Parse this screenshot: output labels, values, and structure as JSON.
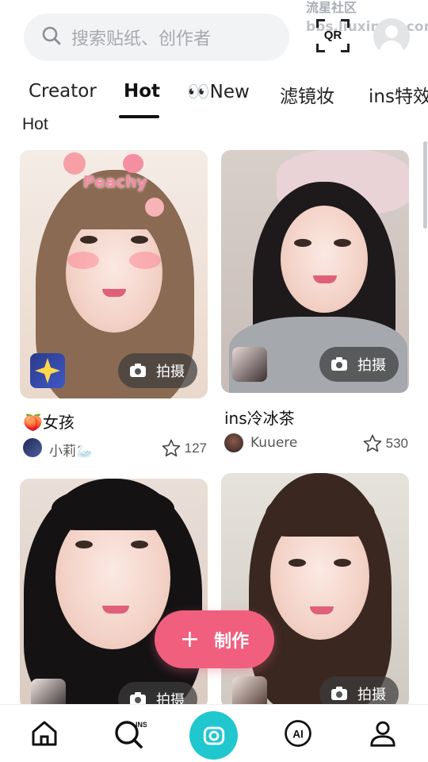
{
  "watermark": {
    "line1": "流星社区",
    "line2": "bbs.liuxingw.com"
  },
  "search": {
    "placeholder": "搜索贴纸、创作者"
  },
  "header": {
    "qr_label": "QR"
  },
  "tabs": [
    {
      "label": "Creator",
      "active": false
    },
    {
      "label": "Hot",
      "active": true
    },
    {
      "label": "👀New",
      "active": false
    },
    {
      "label": "滤镜妆",
      "active": false
    },
    {
      "label": "ins特效",
      "active": false
    }
  ],
  "section_title": "Hot",
  "cards": [
    {
      "title": "🍑女孩",
      "author": "小莉🦢",
      "likes": "127",
      "capture_label": "拍摄",
      "sticker_text": "Peachy"
    },
    {
      "title": "ins冷冰茶",
      "author": "Kuuere",
      "likes": "530",
      "capture_label": "拍摄"
    },
    {
      "title": "",
      "author": "",
      "likes": "",
      "capture_label": "拍摄"
    },
    {
      "title": "",
      "author": "",
      "likes": "",
      "capture_label": "拍摄"
    }
  ],
  "fab": {
    "icon": "+",
    "label": "制作"
  },
  "bottom_nav": [
    "home-icon",
    "ins-search-icon",
    "camera-icon",
    "ai-icon",
    "profile-icon"
  ],
  "nav_labels": {
    "ai": "AI",
    "ins": "INS"
  },
  "colors": {
    "accent_pink": "#f0607e",
    "accent_teal": "#20c7cf",
    "search_bg": "#f2f3f5"
  }
}
